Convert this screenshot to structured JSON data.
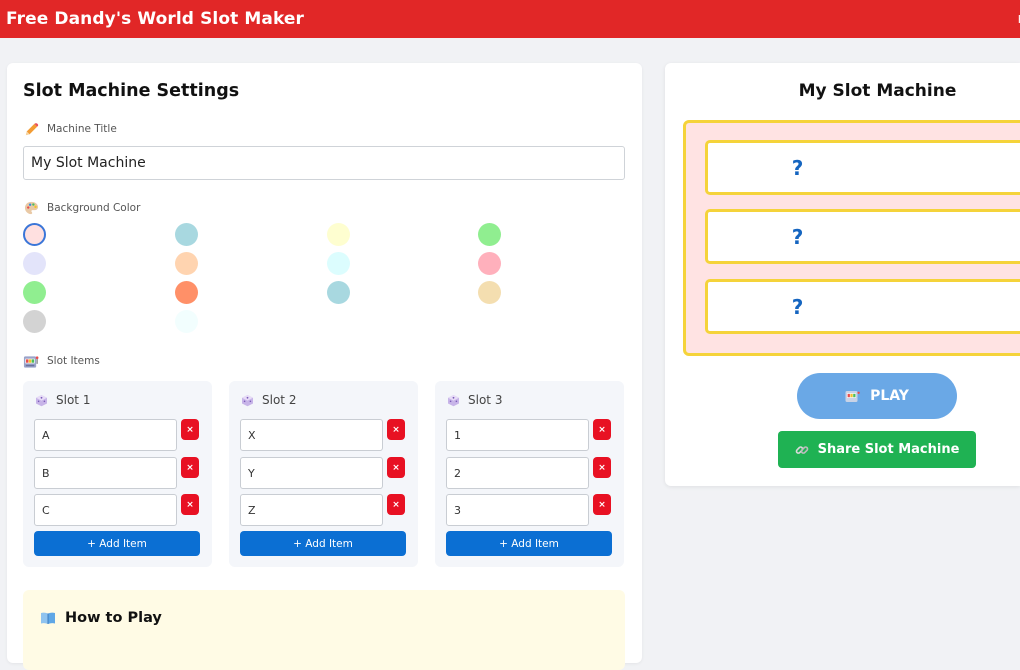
{
  "header": {
    "title": "Free Dandy's World Slot Maker",
    "nav_partial": "H"
  },
  "settings": {
    "heading": "Slot Machine Settings",
    "title_label": "Machine Title",
    "title_value": "My Slot Machine",
    "bg_label": "Background Color",
    "swatches": [
      {
        "color": "#ffe0e0",
        "selected": true
      },
      {
        "color": "#a8d8e0"
      },
      {
        "color": "#fefed0"
      },
      {
        "color": "#90ee90"
      },
      {
        "color": "#e3e4fa"
      },
      {
        "color": "#ffd4b0"
      },
      {
        "color": "#dcfdfe"
      },
      {
        "color": "#ffb0bc"
      },
      {
        "color": "#90ee90"
      },
      {
        "color": "#ff9068"
      },
      {
        "color": "#a8d8e0"
      },
      {
        "color": "#f4deb0"
      },
      {
        "color": "#d3d3d3"
      },
      {
        "color": "#f2fefe"
      }
    ],
    "slot_items_label": "Slot Items",
    "slots": [
      {
        "name": "Slot 1",
        "items": [
          "A",
          "B",
          "C"
        ]
      },
      {
        "name": "Slot 2",
        "items": [
          "X",
          "Y",
          "Z"
        ]
      },
      {
        "name": "Slot 3",
        "items": [
          "1",
          "2",
          "3"
        ]
      }
    ],
    "delete_label": "×",
    "add_item_label": "+ Add Item",
    "howto_title": "How to Play"
  },
  "preview": {
    "title": "My Slot Machine",
    "reels": [
      "?",
      "?",
      "?"
    ],
    "machine_bg": "#ffe3e3",
    "frame_color": "#f5d33a",
    "play_label": "PLAY",
    "share_label": "Share Slot Machine"
  }
}
